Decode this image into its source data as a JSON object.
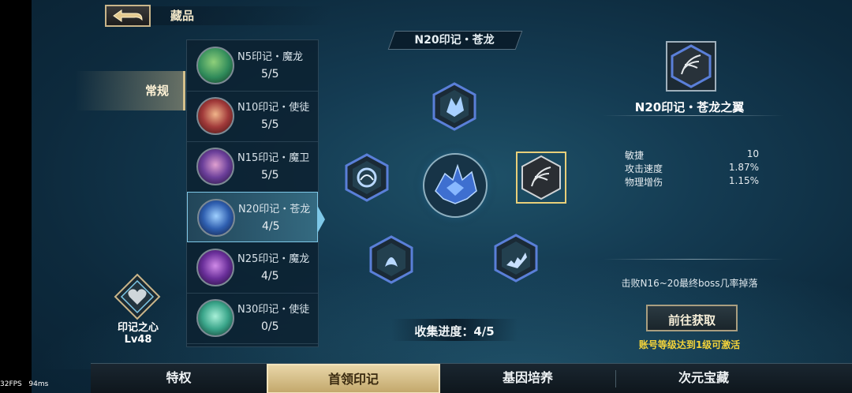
{
  "header": {
    "title": "藏品"
  },
  "side_tab": {
    "label": "常规"
  },
  "collection_list": [
    {
      "name": "N5印记・魔龙",
      "count": "5/5",
      "color": "#2f8a5a"
    },
    {
      "name": "N10印记・使徒",
      "count": "5/5",
      "color": "#a13a3a"
    },
    {
      "name": "N15印记・魔卫",
      "count": "5/5",
      "color": "#6b3f9a"
    },
    {
      "name": "N20印记・苍龙",
      "count": "4/5",
      "color": "#2f5fb0"
    },
    {
      "name": "N25印记・魔龙",
      "count": "4/5",
      "color": "#6a2f9a"
    },
    {
      "name": "N30印记・使徒",
      "count": "0/5",
      "color": "#3aa58a"
    }
  ],
  "heart": {
    "name": "印记之心",
    "level": "Lv48"
  },
  "center": {
    "set_title": "N20印记・苍龙",
    "progress_label": "收集进度：4/5"
  },
  "detail": {
    "title": "N20印记・苍龙之翼",
    "stats": [
      {
        "name": "敏捷",
        "value": "10"
      },
      {
        "name": "攻击速度",
        "value": "1.87%"
      },
      {
        "name": "物理增伤",
        "value": "1.15%"
      }
    ],
    "drop_info": "击败N16~20最终boss几率掉落",
    "obtain_label": "前往获取",
    "unlock_hint": "账号等级达到1级可激活"
  },
  "bottom_tabs": [
    "特权",
    "首领印记",
    "基因培养",
    "次元宝藏"
  ],
  "overlay": {
    "fps": "32FPS",
    "latency": "94ms"
  },
  "colors": {
    "accent_gold": "#d4c08c",
    "selection_blue": "#7ec8e8",
    "hint_yellow": "#f3d33a"
  }
}
